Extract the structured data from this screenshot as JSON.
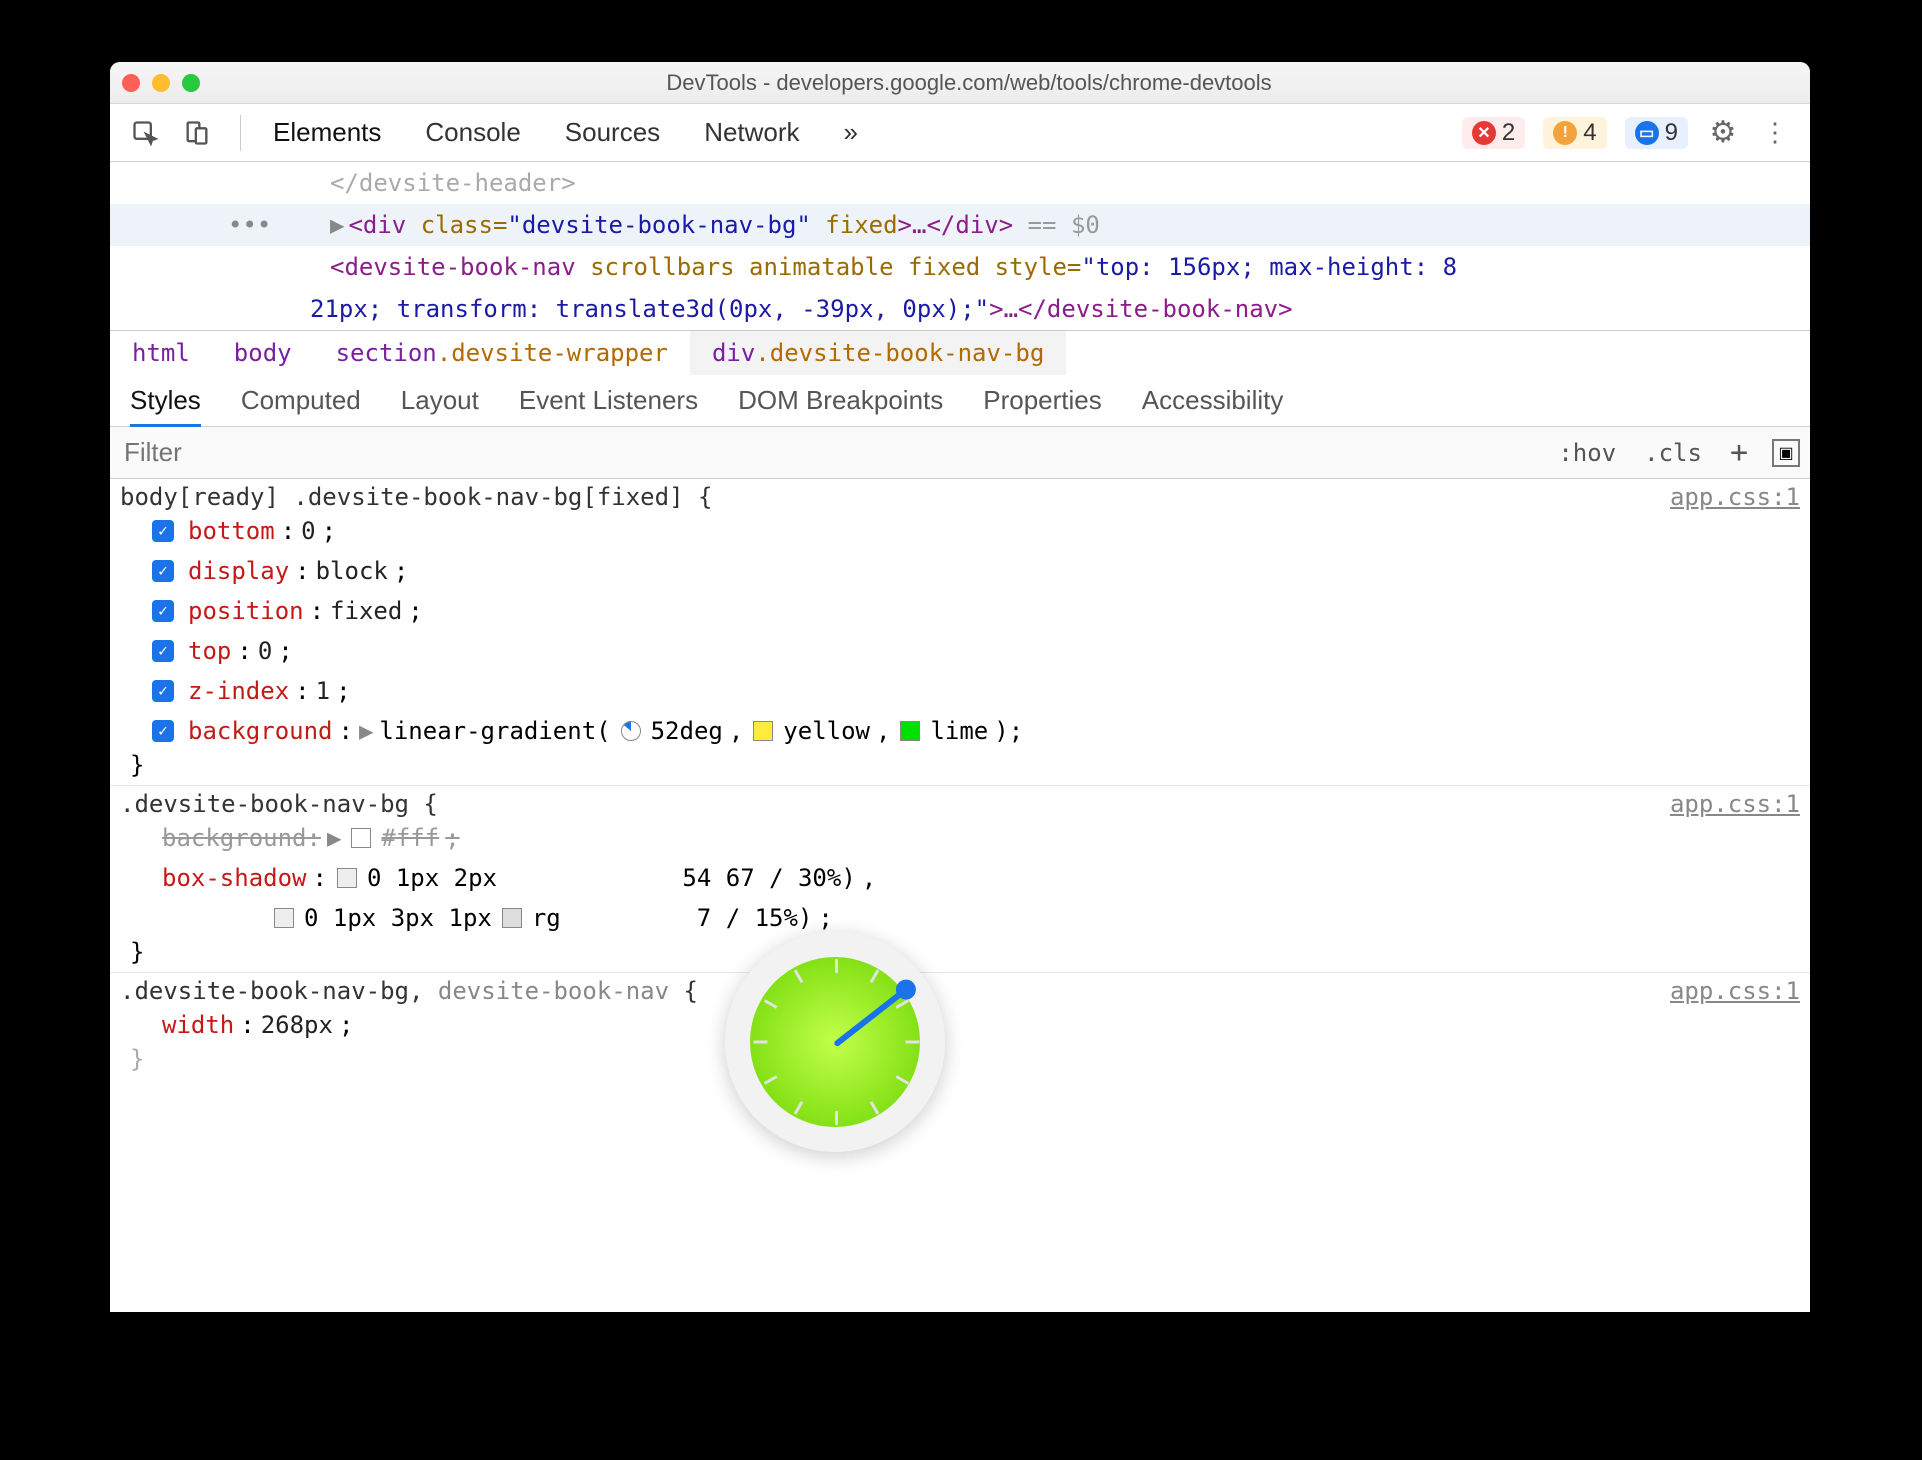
{
  "window": {
    "title": "DevTools - developers.google.com/web/tools/chrome-devtools"
  },
  "toolbar": {
    "tabs": [
      "Elements",
      "Console",
      "Sources",
      "Network"
    ],
    "more_glyph": "»",
    "errors": 2,
    "warnings": 4,
    "issues": 9
  },
  "dom": {
    "line0": "</devsite-header>",
    "line1_open": "<div ",
    "line1_attr": "class=",
    "line1_val": "\"devsite-book-nav-bg\"",
    "line1_attr2": " fixed",
    "line1_mid": ">…</div>",
    "line1_eq": " == $0",
    "line2a": "<devsite-book-nav ",
    "line2b": "scrollbars animatable fixed ",
    "line2c": "style=",
    "line2d": "\"top: 156px; max-height: 8",
    "line3": "21px; transform: translate3d(0px, -39px, 0px);\">…</devsite-book-nav>"
  },
  "breadcrumbs": [
    {
      "tag": "html",
      "cls": ""
    },
    {
      "tag": "body",
      "cls": ""
    },
    {
      "tag": "section",
      "cls": ".devsite-wrapper"
    },
    {
      "tag": "div",
      "cls": ".devsite-book-nav-bg"
    }
  ],
  "subtabs": [
    "Styles",
    "Computed",
    "Layout",
    "Event Listeners",
    "DOM Breakpoints",
    "Properties",
    "Accessibility"
  ],
  "filter": {
    "placeholder": "Filter",
    "hov": ":hov",
    "cls": ".cls"
  },
  "rules": [
    {
      "selector": "body[ready] .devsite-book-nav-bg[fixed] {",
      "source": "app.css:1",
      "decls": [
        {
          "p": "bottom",
          "v": "0"
        },
        {
          "p": "display",
          "v": "block"
        },
        {
          "p": "position",
          "v": "fixed"
        },
        {
          "p": "top",
          "v": "0"
        },
        {
          "p": "z-index",
          "v": "1"
        }
      ],
      "grad": {
        "p": "background",
        "angle": "52deg",
        "c1": "yellow",
        "c1hex": "#ffeb3b",
        "c2": "lime",
        "c2hex": "#00e000"
      }
    },
    {
      "selector": ".devsite-book-nav-bg {",
      "source": "app.css:1",
      "bg_over": {
        "p": "background",
        "v": "#fff"
      },
      "shadow": {
        "p": "box-shadow",
        "v1": "0 1px 2px ",
        "v1b": "54 67 / 30%)",
        "v2": "0 1px 3px 1px ",
        "v2b": "7 / 15%)"
      }
    },
    {
      "selector": ".devsite-book-nav-bg, devsite-book-nav {",
      "source": "app.css:1",
      "decls": [
        {
          "p": "width",
          "v": "268px"
        }
      ]
    }
  ]
}
